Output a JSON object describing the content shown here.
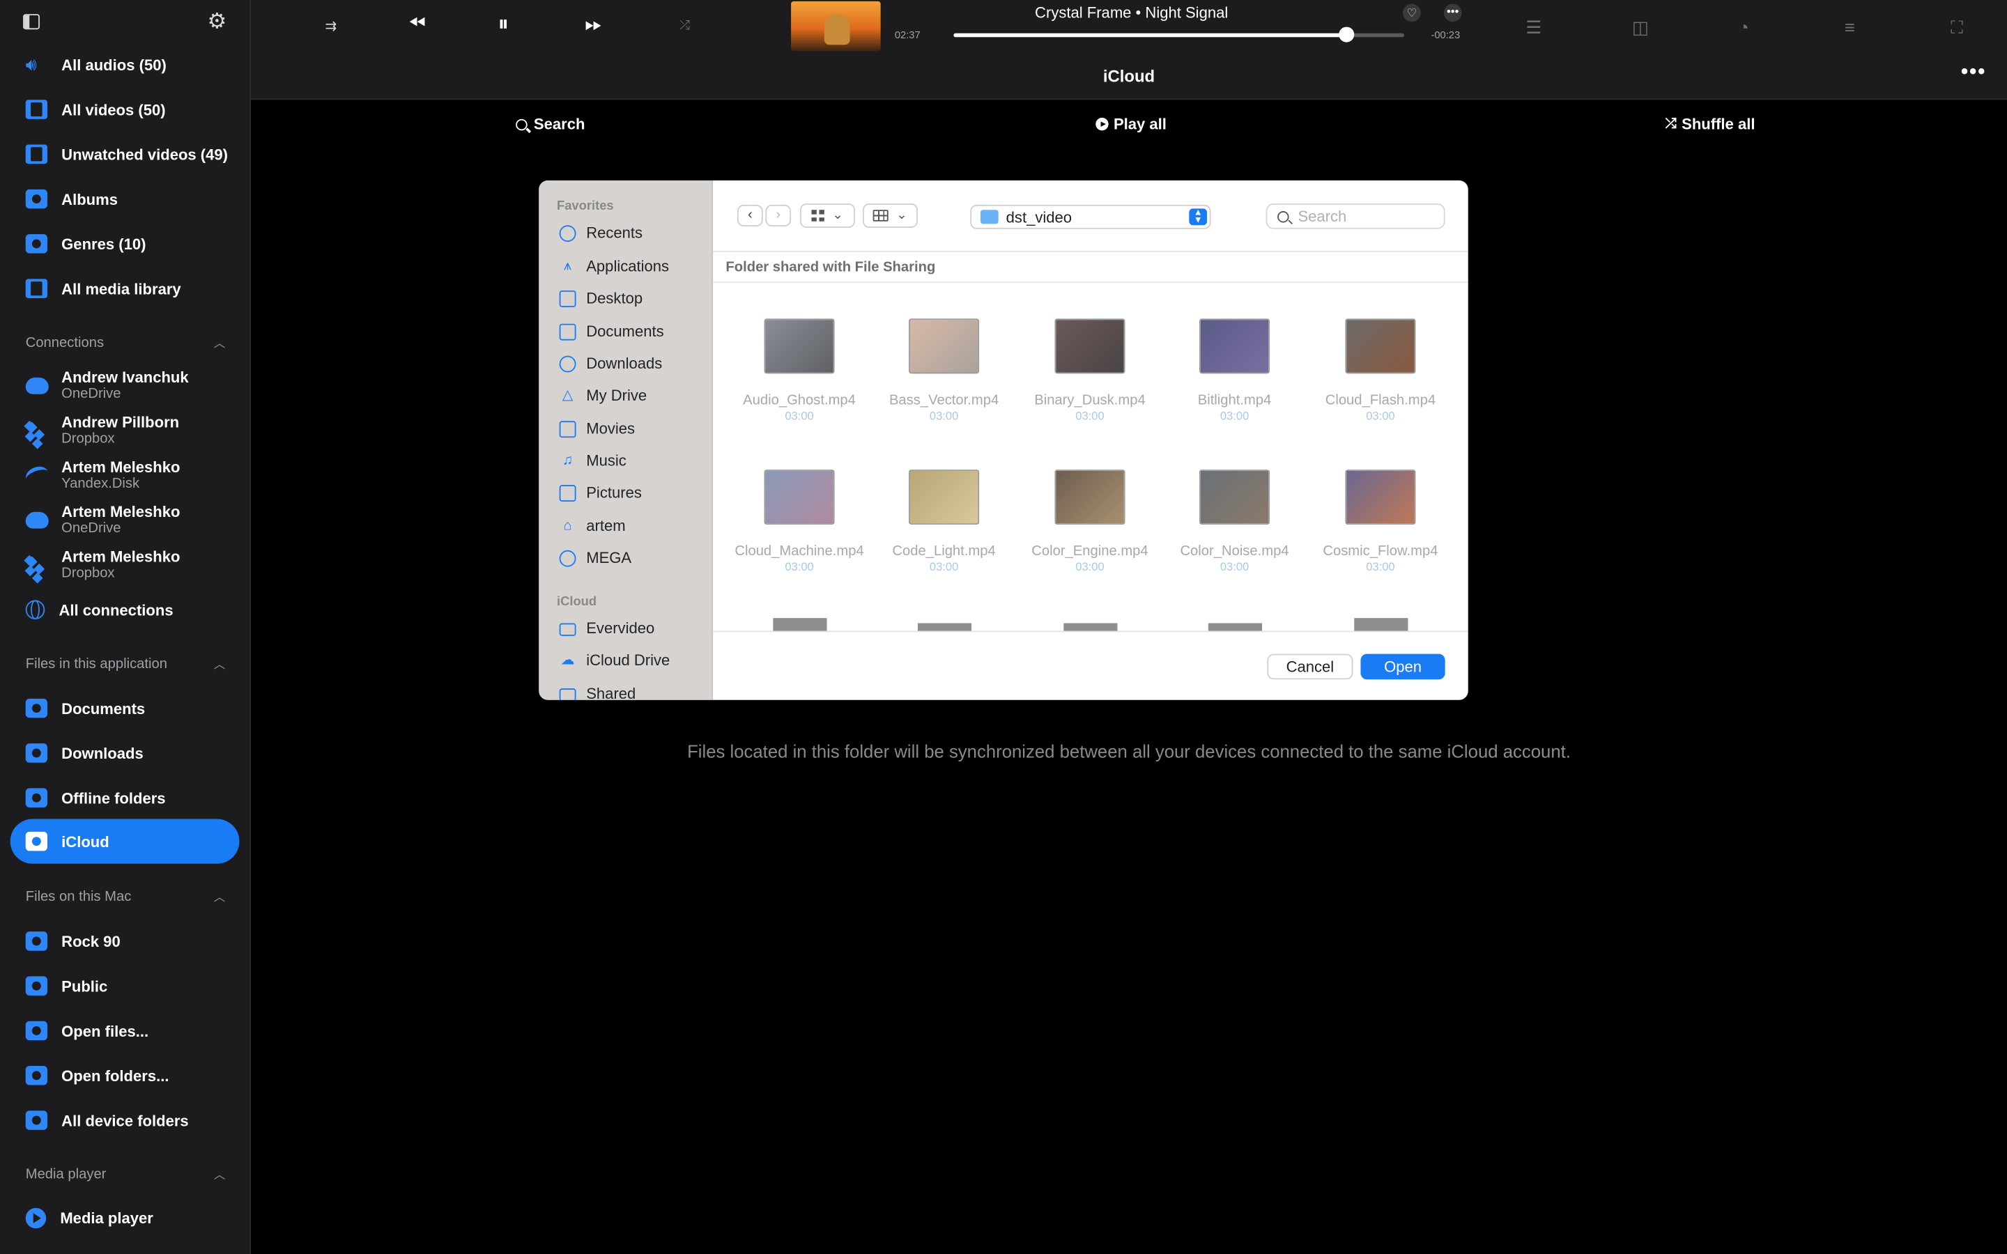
{
  "sidebar": {
    "library": [
      {
        "label": "All audios (50)",
        "icon": "speaker-icon"
      },
      {
        "label": "All videos (50)",
        "icon": "film-icon"
      },
      {
        "label": "Unwatched videos (49)",
        "icon": "film-icon"
      },
      {
        "label": "Albums",
        "icon": "album-icon"
      },
      {
        "label": "Genres (10)",
        "icon": "genre-icon"
      },
      {
        "label": "All media library",
        "icon": "library-icon"
      }
    ],
    "connections_title": "Connections",
    "connections": [
      {
        "name": "Andrew Ivanchuk",
        "service": "OneDrive",
        "icon": "onedrive-icon"
      },
      {
        "name": "Andrew Pillborn",
        "service": "Dropbox",
        "icon": "dropbox-icon"
      },
      {
        "name": "Artem Meleshko",
        "service": "Yandex.Disk",
        "icon": "yandex-disk-icon"
      },
      {
        "name": "Artem Meleshko",
        "service": "OneDrive",
        "icon": "onedrive-icon"
      },
      {
        "name": "Artem Meleshko",
        "service": "Dropbox",
        "icon": "dropbox-icon"
      }
    ],
    "all_connections": "All connections",
    "files_app_title": "Files in this application",
    "files_app": [
      {
        "label": "Documents",
        "icon": "documents-folder-icon"
      },
      {
        "label": "Downloads",
        "icon": "downloads-folder-icon"
      },
      {
        "label": "Offline folders",
        "icon": "offline-folder-icon"
      },
      {
        "label": "iCloud",
        "icon": "icloud-folder-icon",
        "active": true
      }
    ],
    "files_mac_title": "Files on this Mac",
    "files_mac": [
      {
        "label": "Rock 90",
        "icon": "folder-icon"
      },
      {
        "label": "Public",
        "icon": "folder-icon"
      },
      {
        "label": "Open files...",
        "icon": "open-files-icon"
      },
      {
        "label": "Open folders...",
        "icon": "open-folders-icon"
      },
      {
        "label": "All device folders",
        "icon": "folder-icon"
      }
    ],
    "media_player_title": "Media player",
    "media_player": [
      {
        "label": "Media player",
        "icon": "media-player-icon"
      }
    ]
  },
  "player": {
    "track_title": "Crystal Frame • Night Signal",
    "elapsed": "02:37",
    "remaining": "-00:23",
    "progress": 0.872,
    "state": "playing"
  },
  "page": {
    "title": "iCloud",
    "search": "Search",
    "play_all": "Play all",
    "shuffle_all": "Shuffle all",
    "info": "Files located in this folder will be synchronized between all your devices connected to the same iCloud account."
  },
  "dialog": {
    "favorites_title": "Favorites",
    "favorites": [
      {
        "label": "Recents",
        "icon": "clock-icon"
      },
      {
        "label": "Applications",
        "icon": "applications-icon"
      },
      {
        "label": "Desktop",
        "icon": "desktop-icon"
      },
      {
        "label": "Documents",
        "icon": "document-icon"
      },
      {
        "label": "Downloads",
        "icon": "download-icon"
      },
      {
        "label": "My Drive",
        "icon": "google-drive-icon"
      },
      {
        "label": "Movies",
        "icon": "film-icon"
      },
      {
        "label": "Music",
        "icon": "music-note-icon"
      },
      {
        "label": "Pictures",
        "icon": "photo-icon"
      },
      {
        "label": "artem",
        "icon": "home-icon"
      },
      {
        "label": "MEGA",
        "icon": "mega-icon"
      }
    ],
    "icloud_title": "iCloud",
    "icloud": [
      {
        "label": "Evervideo",
        "icon": "folder-icon"
      },
      {
        "label": "iCloud Drive",
        "icon": "icloud-icon"
      },
      {
        "label": "Shared",
        "icon": "shared-folder-icon"
      }
    ],
    "path": "dst_video",
    "search_placeholder": "Search",
    "section_header": "Folder shared with File Sharing",
    "files": [
      {
        "name": "Audio_Ghost.mp4",
        "duration": "03:00"
      },
      {
        "name": "Bass_Vector.mp4",
        "duration": "03:00"
      },
      {
        "name": "Binary_Dusk.mp4",
        "duration": "03:00"
      },
      {
        "name": "Bitlight.mp4",
        "duration": "03:00"
      },
      {
        "name": "Cloud_Flash.mp4",
        "duration": "03:00"
      },
      {
        "name": "Cloud_Machine.mp4",
        "duration": "03:00"
      },
      {
        "name": "Code_Light.mp4",
        "duration": "03:00"
      },
      {
        "name": "Color_Engine.mp4",
        "duration": "03:00"
      },
      {
        "name": "Color_Noise.mp4",
        "duration": "03:00"
      },
      {
        "name": "Cosmic_Flow.mp4",
        "duration": "03:00"
      }
    ],
    "cancel": "Cancel",
    "open": "Open"
  }
}
